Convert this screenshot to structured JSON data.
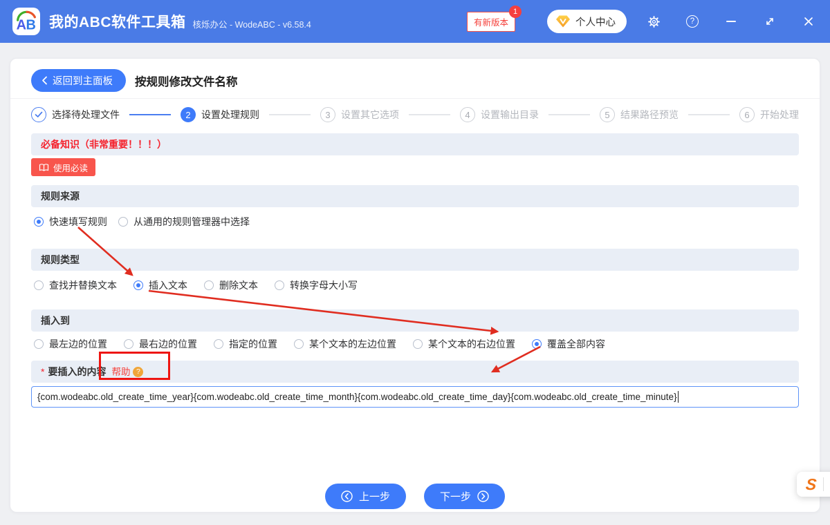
{
  "colors": {
    "titlebar_blue": "#4a7be6",
    "accent_blue": "#3e7bfa",
    "section_bar_bg": "#e9eef6",
    "danger_red": "#f8554c",
    "notice_red": "#f5222d",
    "annotation_red": "#e02d20",
    "s_logo_orange": "#f07518"
  },
  "titlebar": {
    "app_title": "我的ABC软件工具箱",
    "app_subtitle": "核烁办公 - WodeABC - v6.58.4",
    "update_badge": "有新版本",
    "update_count": "1",
    "user_center": "个人中心",
    "help_glyph": "?"
  },
  "header": {
    "back_label": "返回到主面板",
    "page_title": "按规则修改文件名称"
  },
  "steps": [
    {
      "number": "1",
      "label": "选择待处理文件",
      "state": "done"
    },
    {
      "number": "2",
      "label": "设置处理规则",
      "state": "active"
    },
    {
      "number": "3",
      "label": "设置其它选项",
      "state": "pending"
    },
    {
      "number": "4",
      "label": "设置输出目录",
      "state": "pending"
    },
    {
      "number": "5",
      "label": "结果路径预览",
      "state": "pending"
    },
    {
      "number": "6",
      "label": "开始处理",
      "state": "pending"
    }
  ],
  "notice": {
    "title": "必备知识（非常重要！！！）",
    "read_button": "使用必读"
  },
  "sections": {
    "rule_source": {
      "title": "规则来源",
      "options": [
        {
          "id": "quick-fill-rule",
          "label": "快速填写规则",
          "selected": true
        },
        {
          "id": "from-rule-manager",
          "label": "从通用的规则管理器中选择",
          "selected": false
        }
      ]
    },
    "rule_type": {
      "title": "规则类型",
      "options": [
        {
          "id": "find-replace-text",
          "label": "查找并替换文本",
          "selected": false
        },
        {
          "id": "insert-text",
          "label": "插入文本",
          "selected": true
        },
        {
          "id": "delete-text",
          "label": "删除文本",
          "selected": false
        },
        {
          "id": "convert-case",
          "label": "转换字母大小写",
          "selected": false
        }
      ]
    },
    "insert_to": {
      "title": "插入到",
      "options": [
        {
          "id": "leftmost-position",
          "label": "最左边的位置",
          "selected": false
        },
        {
          "id": "rightmost-position",
          "label": "最右边的位置",
          "selected": false
        },
        {
          "id": "specified-position",
          "label": "指定的位置",
          "selected": false
        },
        {
          "id": "left-of-text",
          "label": "某个文本的左边位置",
          "selected": false
        },
        {
          "id": "right-of-text",
          "label": "某个文本的右边位置",
          "selected": false
        },
        {
          "id": "overwrite-all",
          "label": "覆盖全部内容",
          "selected": true
        }
      ]
    },
    "insert_content": {
      "required_mark": "*",
      "title": "要插入的内容",
      "help_label": "帮助",
      "help_glyph": "?",
      "input_value": "{com.wodeabc.old_create_time_year}{com.wodeabc.old_create_time_month}{com.wodeabc.old_create_time_day}{com.wodeabc.old_create_time_minute}"
    }
  },
  "footer": {
    "prev_label": "上一步",
    "next_label": "下一步"
  },
  "overlay": {
    "s_logo": "S"
  }
}
